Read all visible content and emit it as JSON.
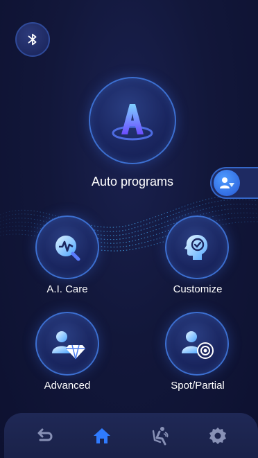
{
  "colors": {
    "accent": "#2f7bff",
    "nav_active": "#2f7bff",
    "nav_inactive": "#8891b6",
    "ring": "#3c6fd0"
  },
  "header": {
    "bluetooth_icon": "bluetooth-icon"
  },
  "main": {
    "auto_programs": {
      "label": "Auto programs",
      "icon": "auto-a-icon"
    },
    "grid": [
      {
        "label": "A.I. Care",
        "icon": "ai-care-icon"
      },
      {
        "label": "Customize",
        "icon": "customize-icon"
      },
      {
        "label": "Advanced",
        "icon": "advanced-icon"
      },
      {
        "label": "Spot/Partial",
        "icon": "spot-partial-icon"
      }
    ]
  },
  "side_tab": {
    "icon": "user-diamond-icon"
  },
  "bottom_nav": [
    {
      "icon": "back-icon",
      "active": false
    },
    {
      "icon": "home-icon",
      "active": true
    },
    {
      "icon": "massage-chair-icon",
      "active": false
    },
    {
      "icon": "settings-icon",
      "active": false
    }
  ]
}
